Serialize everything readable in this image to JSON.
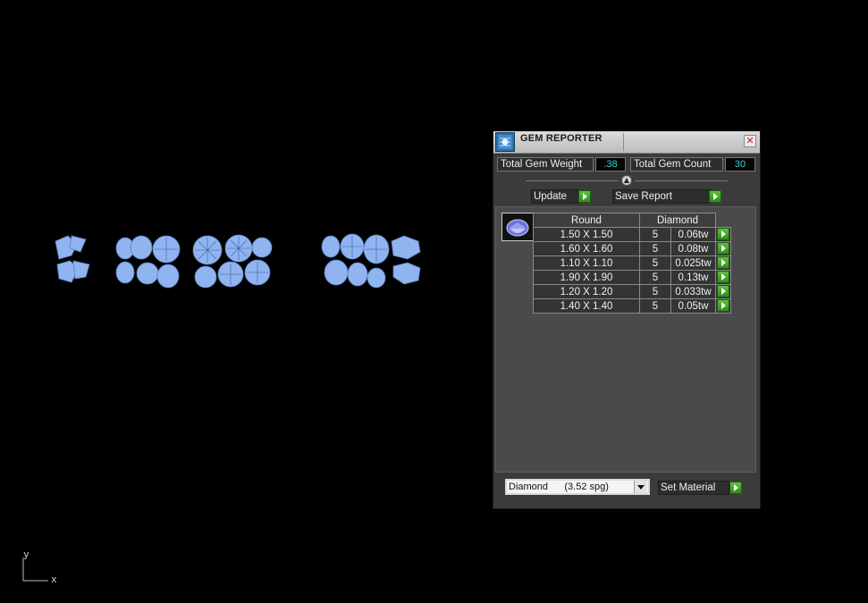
{
  "panel": {
    "title": "GEM REPORTER",
    "close_symbol": "✕",
    "total_weight_label": "Total Gem Weight",
    "total_weight_value": ".38",
    "total_count_label": "Total Gem Count",
    "total_count_value": "30",
    "update_label": "Update",
    "save_report_label": "Save Report",
    "table": {
      "headers": [
        "Round",
        "Diamond"
      ],
      "rows": [
        {
          "size": "1.50 X 1.50",
          "count": "5",
          "weight": "0.06tw"
        },
        {
          "size": "1.60 X 1.60",
          "count": "5",
          "weight": "0.08tw"
        },
        {
          "size": "1.10 X 1.10",
          "count": "5",
          "weight": "0.025tw"
        },
        {
          "size": "1.90 X 1.90",
          "count": "5",
          "weight": "0.13tw"
        },
        {
          "size": "1.20 X 1.20",
          "count": "5",
          "weight": "0.033tw"
        },
        {
          "size": "1.40 X 1.40",
          "count": "5",
          "weight": "0.05tw"
        }
      ]
    },
    "material_select": "Diamond      (3.52 spg)",
    "set_material_label": "Set Material"
  },
  "axis": {
    "y": "y",
    "x": "x"
  },
  "colors": {
    "gem": "#8fb4f0",
    "accent": "#36d3d8",
    "go": "#3ea82a"
  }
}
